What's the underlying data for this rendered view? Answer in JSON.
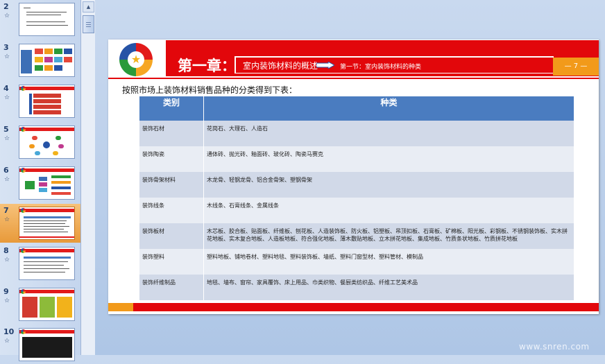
{
  "thumbnails": [
    {
      "number": "2"
    },
    {
      "number": "3"
    },
    {
      "number": "4"
    },
    {
      "number": "5"
    },
    {
      "number": "6"
    },
    {
      "number": "7",
      "selected": true
    },
    {
      "number": "8"
    },
    {
      "number": "9"
    },
    {
      "number": "10"
    }
  ],
  "slide": {
    "chapter_title": "第一章：",
    "subtitle": "室内装饰材料的概述",
    "section_title": "第一节：室内装饰材料的种类",
    "page_number": "— 7 —",
    "intro": "按照市场上装饰材料销售品种的分类得到下表：",
    "table": {
      "headers": [
        "类别",
        "种类"
      ],
      "rows": [
        {
          "category": "装饰石材",
          "types": "花岗石、大理石、人造石"
        },
        {
          "category": "装饰陶瓷",
          "types": "通体砖、抛光砖、釉面砖、玻化砖、陶瓷马赛克"
        },
        {
          "category": "装饰骨架材料",
          "types": "木龙骨、轻钢龙骨、铝合金骨架、塑钢骨架"
        },
        {
          "category": "装饰线条",
          "types": "木线条、石膏线条、金属线条"
        },
        {
          "category": "装饰板材",
          "types": "木芯板、胶合板、贴面板、纤维板、刨花板、人造装饰板、防火板、铝塑板、吊顶扣板、石膏板、矿棉板、阳光板、彩钢板、不锈钢装饰板、实木拼花地板、实木复合地板、人造板地板、符合强化地板、薄木敷贴地板、立木拼花地板、集成地板、竹质条状地板、竹质拼花地板"
        },
        {
          "category": "装饰塑料",
          "types": "塑料地板、铺地卷材、塑料地毯、塑料装饰板、墙纸、塑料门窗型材、塑料管材、模制品"
        },
        {
          "category": "装饰纤维制品",
          "types": "地毯、墙布、窗帘、家具覆饰、床上用品、巾类织物、餐厨类纺织品、纤维工艺美术品"
        }
      ]
    }
  },
  "watermark": "www.snren.com",
  "colors": {
    "accent_red": "#e2070b",
    "accent_orange": "#f29a1a",
    "table_header": "#4a7cc0",
    "selection": "#e89a3a"
  }
}
